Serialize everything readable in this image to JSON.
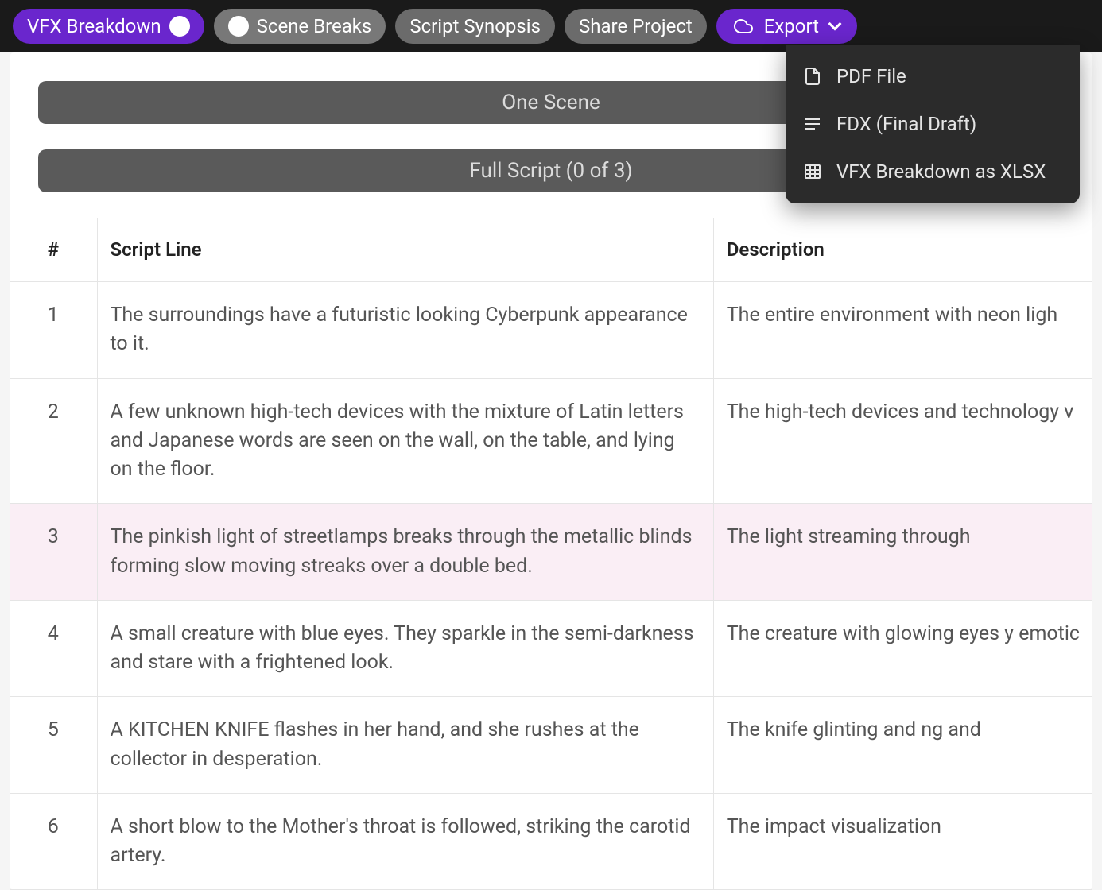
{
  "toolbar": {
    "vfx_breakdown": "VFX Breakdown",
    "scene_breaks": "Scene Breaks",
    "script_synopsis": "Script Synopsis",
    "share_project": "Share Project",
    "export": "Export"
  },
  "export_menu": {
    "pdf": "PDF File",
    "fdx": "FDX (Final Draft)",
    "xlsx": "VFX Breakdown as XLSX"
  },
  "bars": {
    "one_scene": "One Scene",
    "full_script": "Full Script (0 of 3)"
  },
  "table": {
    "headers": {
      "num": "#",
      "script_line": "Script Line",
      "description": "Description"
    },
    "rows": [
      {
        "num": "1",
        "script_line": "The surroundings have a futuristic looking Cyberpunk appearance to it.",
        "description": "The entire environment with neon ligh",
        "highlighted": false
      },
      {
        "num": "2",
        "script_line": "A few unknown high-tech devices with the mixture of Latin letters and Japanese words are seen on the wall, on the table, and lying on the floor.",
        "description": "The high-tech devices and technology v",
        "highlighted": false
      },
      {
        "num": "3",
        "script_line": "The pinkish light of streetlamps breaks through the metallic blinds forming slow moving streaks over a double bed.",
        "description": "The light streaming through",
        "highlighted": true
      },
      {
        "num": "4",
        "script_line": "A small creature with blue eyes. They sparkle in the semi-darkness and stare with a frightened look.",
        "description": "The creature with glowing eyes y emotic",
        "highlighted": false
      },
      {
        "num": "5",
        "script_line": "A KITCHEN KNIFE flashes in her hand, and she rushes at the collector in desperation.",
        "description": "The knife glinting and ng and",
        "highlighted": false
      },
      {
        "num": "6",
        "script_line": "A short blow to the Mother's throat is followed, striking the carotid artery.",
        "description": "The impact visualization",
        "highlighted": false
      }
    ]
  }
}
